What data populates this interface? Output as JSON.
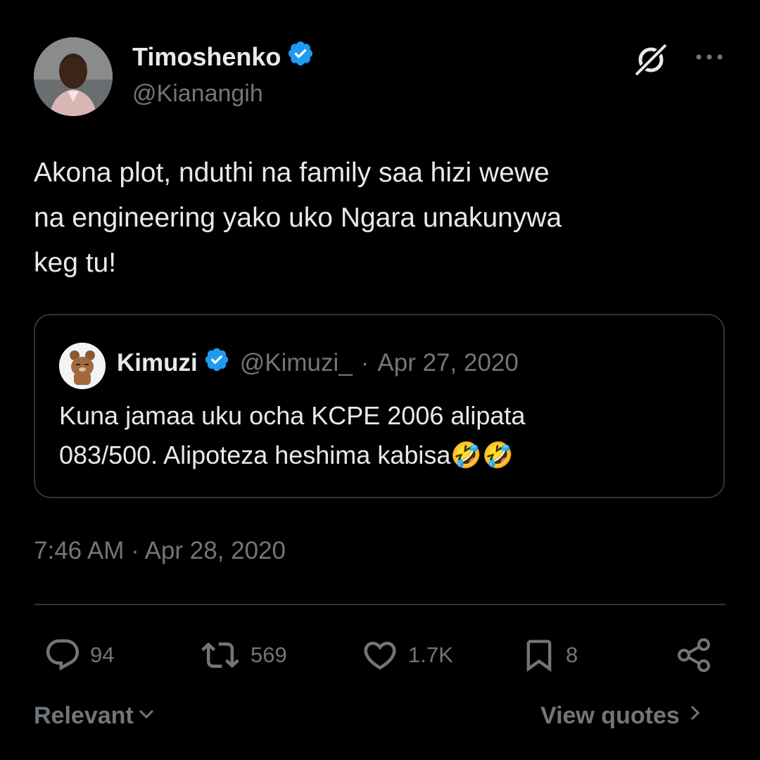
{
  "author": {
    "name": "Timoshenko",
    "handle": "@Kianangih",
    "verified": true
  },
  "header_icons": [
    "grok-icon",
    "more-icon"
  ],
  "tweet": {
    "lines": [
      "Akona plot, nduthi na family saa hizi wewe",
      "na engineering yako uko Ngara unakunywa",
      "keg tu!"
    ],
    "timestamp": "7:46 AM · Apr 28, 2020"
  },
  "quote": {
    "name": "Kimuzi",
    "handle": "@Kimuzi_",
    "separator": "·",
    "date": "Apr 27, 2020",
    "verified": true,
    "lines": [
      "Kuna jamaa uku ocha KCPE 2006 alipata",
      "083/500. Alipoteza heshima kabisa🤣🤣"
    ]
  },
  "actions": {
    "replies": "94",
    "reposts": "569",
    "likes": "1.7K",
    "bookmarks": "8"
  },
  "footer": {
    "sort_label": "Relevant",
    "view_quotes_label": "View quotes"
  },
  "colors": {
    "background": "#000000",
    "text": "#e7e9ea",
    "secondary": "#71767b",
    "border": "#2f3336",
    "verified": "#1d9bf0"
  }
}
